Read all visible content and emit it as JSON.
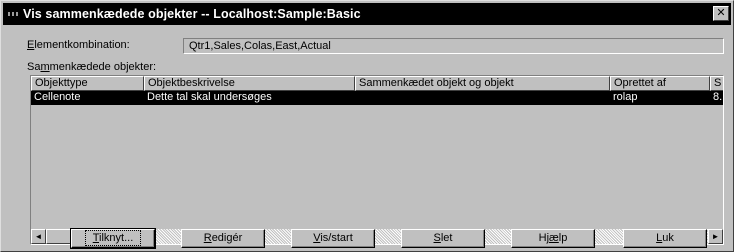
{
  "window": {
    "title": "Vis sammenkædede objekter -- Localhost:Sample:Basic",
    "close_glyph": "✕"
  },
  "element_combination": {
    "label_hotkey": "E",
    "label_rest": "lementkombination:",
    "value": "Qtr1,Sales,Colas,East,Actual"
  },
  "linked_objects": {
    "label_pre": "Sa",
    "label_hotkey": "m",
    "label_post": "menkædede objekter:",
    "columns": [
      "Objekttype",
      "Objektbeskrivelse",
      "Sammenkædet objekt og objekt",
      "Oprettet af",
      "S"
    ],
    "rows": [
      {
        "selected": true,
        "cells": [
          "Cellenote",
          "Dette tal skal undersøges",
          "",
          "rolap",
          "8."
        ]
      }
    ]
  },
  "scrollbar": {
    "left_arrow": "◄",
    "right_arrow": "►"
  },
  "buttons": {
    "attach": {
      "hotkey": "T",
      "rest": "ilknyt..."
    },
    "edit": {
      "hotkey": "R",
      "rest": "edigér"
    },
    "view": {
      "hotkey": "V",
      "rest": "is/start"
    },
    "delete": {
      "hotkey": "S",
      "rest": "let"
    },
    "help": {
      "pre": "Hj",
      "hotkey": "æ",
      "post": "lp"
    },
    "close": {
      "hotkey": "L",
      "rest": "uk"
    }
  }
}
